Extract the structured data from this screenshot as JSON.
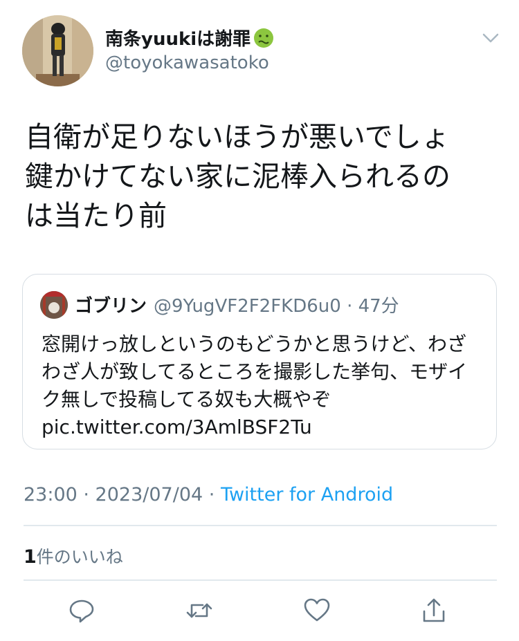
{
  "user": {
    "display_name": "南条yuukiは謝罪",
    "handle": "@toyokawasatoko",
    "emoji": "nauseated-face-icon"
  },
  "tweet": {
    "lines": [
      "自衛が足りないほうが悪いでしょ",
      "鍵かけてない家に泥棒入られるの",
      "は当たり前"
    ]
  },
  "quote": {
    "name": "ゴブリン",
    "handle_time": "@9YugVF2F2FKD6u0 · 47分",
    "lines": [
      "窓開けっ放しというのもどうかと思うけど、わざ",
      "わざ人が致してるところを撮影した挙句、モザイ",
      "ク無しで投稿してる奴も大概やぞ",
      "pic.twitter.com/3AmlBSF2Tu"
    ]
  },
  "meta": {
    "time_date": "23:00 · 2023/07/04 · ",
    "source": "Twitter for Android"
  },
  "likes": {
    "count": "1",
    "label": "件のいいね"
  },
  "actions": [
    "reply-icon",
    "retweet-icon",
    "like-icon",
    "share-icon"
  ],
  "colors": {
    "text": "#14171a",
    "secondary": "#657786",
    "link": "#1da1f2",
    "border": "#e1e8ed"
  }
}
